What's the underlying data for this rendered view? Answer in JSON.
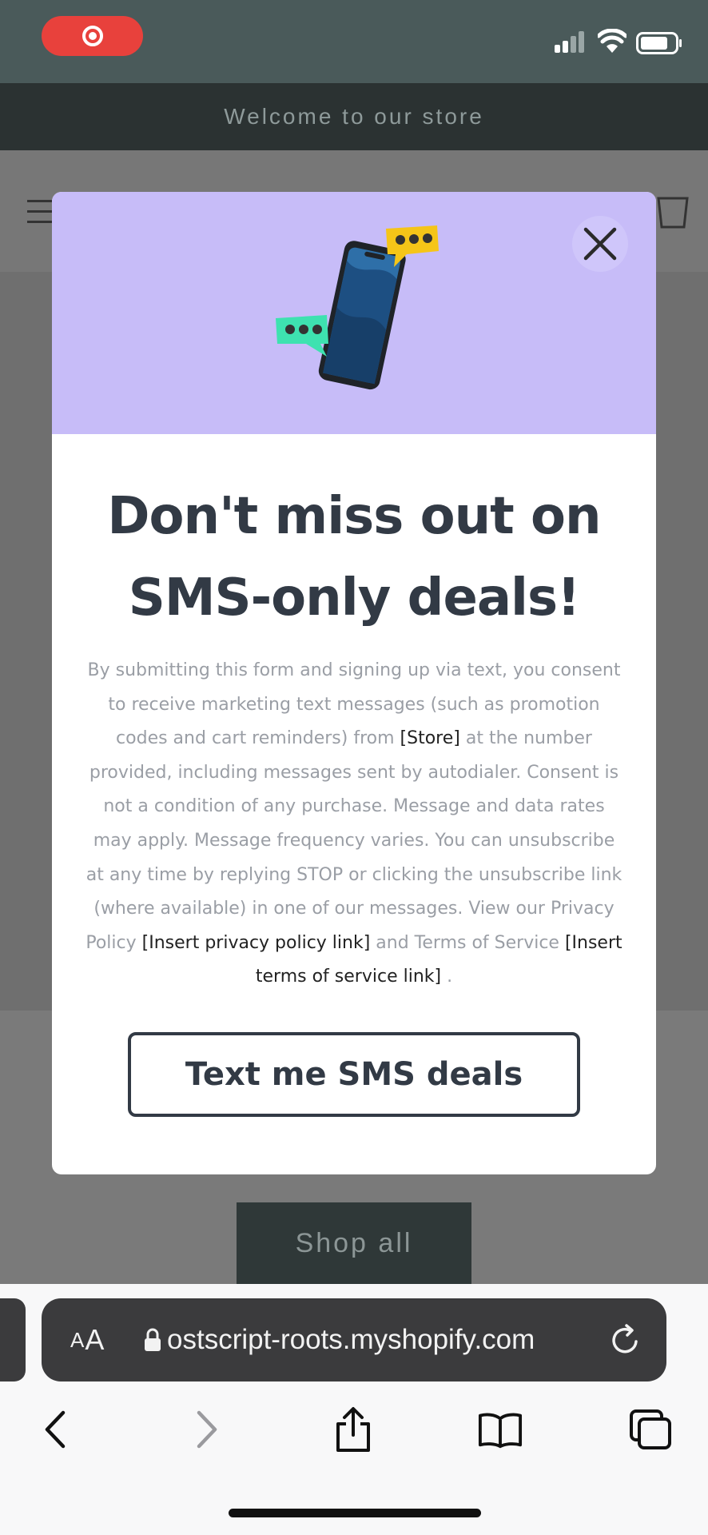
{
  "status_bar": {
    "recording_icon": "screen-record-icon",
    "signal_icon": "cellular-signal-icon",
    "wifi_icon": "wifi-icon",
    "battery_icon": "battery-icon"
  },
  "store": {
    "announcement": "Welcome to our store",
    "shop_all_label": "Shop all"
  },
  "modal": {
    "title": "Don't miss out on SMS-only deals!",
    "body": {
      "p1": "By submitting this form and signing up via text, you consent to receive marketing text messages (such as promotion codes and cart reminders) from ",
      "store": "[Store]",
      "p2": " at the number provided, including messages sent by autodialer. Consent is not a condition of any purchase. Message and data rates may apply. Message frequency varies. You can unsubscribe at any time by replying STOP or clicking the unsubscribe link (where available) in one of our messages. View our Privacy Policy ",
      "privacy_link": "[Insert privacy policy link]",
      "p3": " and Terms of Service ",
      "terms_link": "[Insert terms of service link]",
      "p4": " ."
    },
    "cta_label": "Text me SMS deals",
    "banner_color": "#c7bcf8"
  },
  "browser": {
    "aa_label_small": "A",
    "aa_label_big": "A",
    "url": "ostscript-roots.myshopify.com",
    "nav": {
      "back_icon": "chevron-left-icon",
      "forward_icon": "chevron-right-icon",
      "share_icon": "share-icon",
      "bookmarks_icon": "book-icon",
      "tabs_icon": "tabs-icon"
    }
  }
}
